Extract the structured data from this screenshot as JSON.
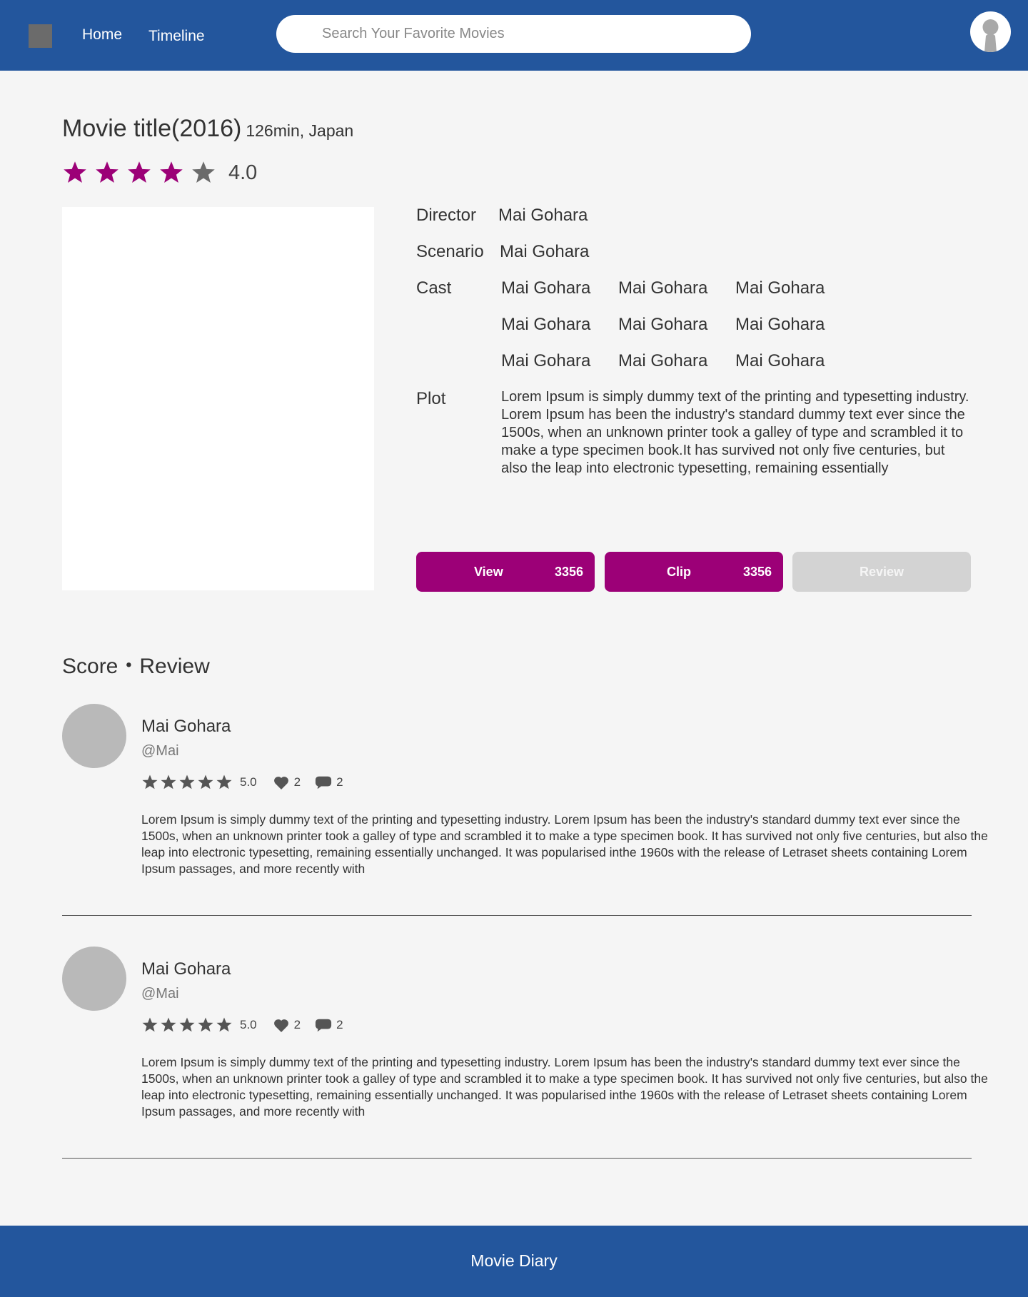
{
  "header": {
    "nav": {
      "home": "Home",
      "timeline": "Timeline"
    },
    "search": {
      "placeholder": "Search Your Favorite Movies"
    },
    "logo_icon": "app-logo-square",
    "profile_icon": "user-avatar-icon"
  },
  "movie": {
    "title": "Movie title(2016)",
    "meta": "126min, Japan",
    "rating": {
      "value": "4.0",
      "stars_filled": 4,
      "stars_total": 5,
      "filled_color": "#9c0077",
      "empty_color": "#6b6b6b"
    },
    "details": {
      "director_label": "Director",
      "director": "Mai Gohara",
      "scenario_label": "Scenario",
      "scenario": "Mai Gohara",
      "cast_label": "Cast",
      "cast": [
        "Mai Gohara",
        "Mai Gohara",
        "Mai Gohara",
        "Mai Gohara",
        "Mai Gohara",
        "Mai Gohara",
        "Mai Gohara",
        "Mai Gohara",
        "Mai Gohara"
      ],
      "plot_label": "Plot",
      "plot": "Lorem Ipsum is simply dummy text of the printing and typesetting industry. Lorem Ipsum has been the industry's standard dummy text ever since the 1500s, when an unknown printer took a galley of type and scrambled it to make a type specimen book.It has survived not only five centuries, but also the leap into electronic typesetting, remaining essentially"
    },
    "actions": {
      "view_label": "View",
      "view_count": "3356",
      "clip_label": "Clip",
      "clip_count": "3356",
      "review_label": "Review"
    }
  },
  "reviews_section": {
    "title": "Score・Review",
    "items": [
      {
        "name": "Mai Gohara",
        "handle": "@Mai",
        "score": "5.0",
        "likes": "2",
        "comments": "2",
        "text": "Lorem Ipsum is simply dummy text of the printing and typesetting industry. Lorem Ipsum has been the industry's standard dummy text ever since the 1500s, when an unknown printer took a galley of type and scrambled it to make a type specimen book. It has survived not only five centuries, but also the leap into electronic typesetting, remaining essentially unchanged. It was popularised inthe 1960s with the release of Letraset sheets containing Lorem Ipsum passages, and more recently with"
      },
      {
        "name": "Mai Gohara",
        "handle": "@Mai",
        "score": "5.0",
        "likes": "2",
        "comments": "2",
        "text": "Lorem Ipsum is simply dummy text of the printing and typesetting industry. Lorem Ipsum has been the industry's standard dummy text ever since the 1500s, when an unknown printer took a galley of type and scrambled it to make a type specimen book. It has survived not only five centuries, but also the leap into electronic typesetting, remaining essentially unchanged. It was popularised inthe 1960s with the release of Letraset sheets containing Lorem Ipsum passages, and more recently with"
      }
    ]
  },
  "footer": {
    "title": "Movie Diary"
  },
  "colors": {
    "header_bg": "#23569d",
    "accent": "#9c0077",
    "page_bg": "#f5f5f5",
    "disabled": "#d3d3d3"
  }
}
